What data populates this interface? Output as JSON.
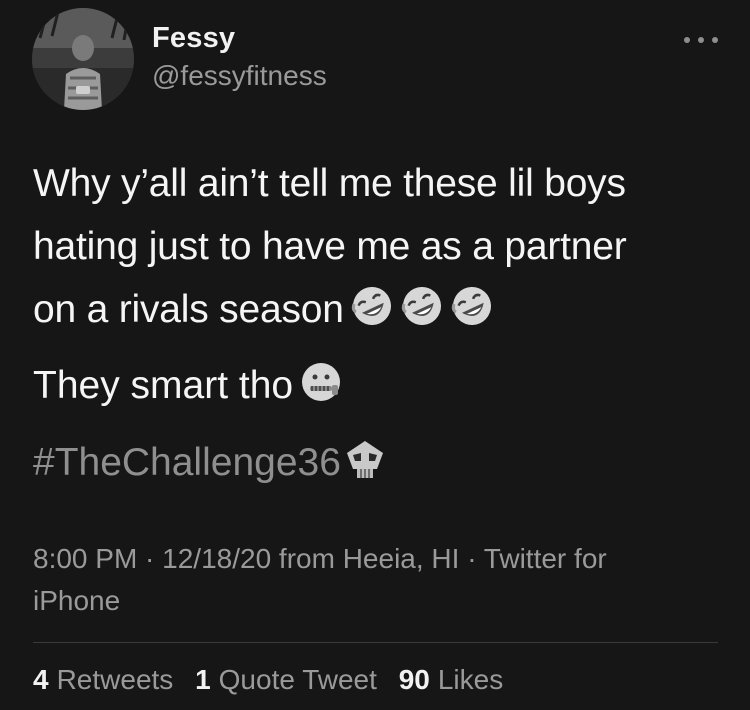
{
  "user": {
    "display_name": "Fessy",
    "handle": "@fessyfitness"
  },
  "more_icon": "more-horizontal-icon",
  "tweet": {
    "lines": [
      "Why y’all ain’t tell me these lil boys",
      "hating just to have me as a partner",
      "on a rivals season"
    ],
    "line3_emojis": [
      "rofl-emoji",
      "rofl-emoji",
      "rofl-emoji"
    ],
    "second_paragraph": "They smart tho",
    "second_emoji": "zipper-mouth-emoji",
    "hashtag": "#TheChallenge36",
    "hashtag_emoji": "skull-emoji"
  },
  "meta": {
    "text": "8:00 PM · 12/18/20 from Heeia, HI · Twitter for iPhone"
  },
  "stats": {
    "retweets_count": "4",
    "retweets_label": "Retweets",
    "quotes_count": "1",
    "quotes_label": "Quote Tweet",
    "likes_count": "90",
    "likes_label": "Likes"
  },
  "colors": {
    "background": "#161616",
    "text": "#f5f5f5",
    "secondary": "#9a9a9a",
    "hashtag": "#8f8f8f"
  }
}
